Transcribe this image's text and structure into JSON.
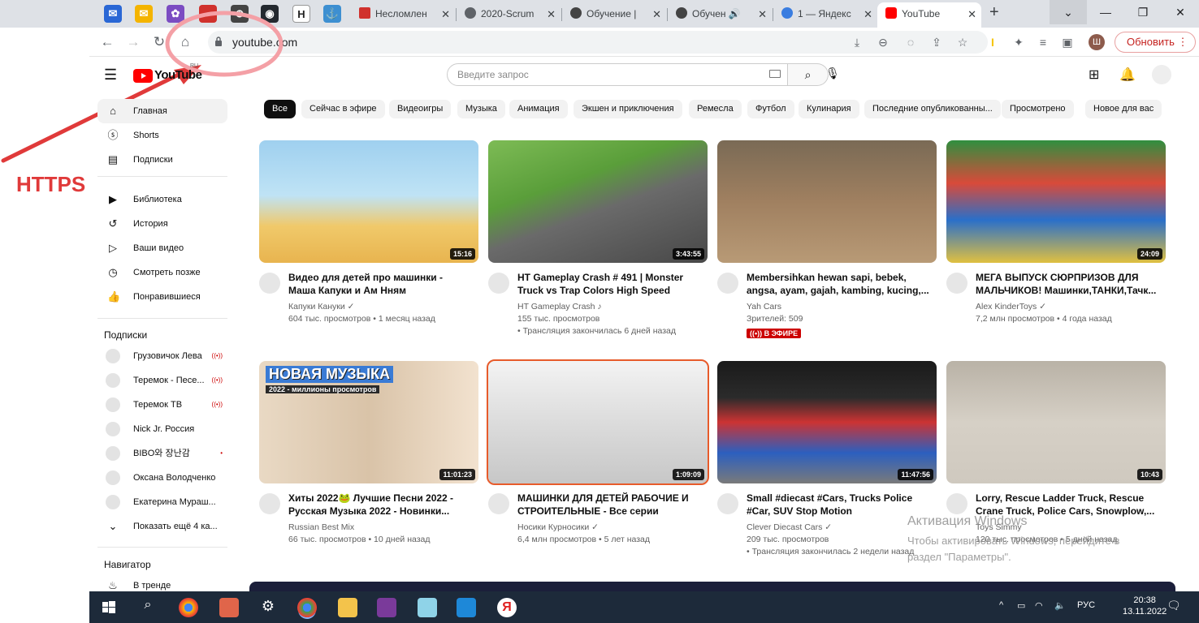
{
  "browser": {
    "tabs": [
      {
        "label": "Несломлен"
      },
      {
        "label": "2020-Scrum"
      },
      {
        "label": "Обучение |"
      },
      {
        "label": "Обучен"
      },
      {
        "label": "1 — Яндекс"
      },
      {
        "label": "YouTube"
      }
    ],
    "new_tab": "+",
    "url": "youtube.com",
    "update_label": "Обновить",
    "profile_initial": "Ш"
  },
  "youtube": {
    "logo": "YouTube",
    "logo_region": "RU",
    "search_placeholder": "Введите запрос",
    "sidebar": {
      "main": [
        {
          "label": "Главная",
          "icon": "home-icon"
        },
        {
          "label": "Shorts",
          "icon": "shorts-icon"
        },
        {
          "label": "Подписки",
          "icon": "subscriptions-icon"
        }
      ],
      "library": [
        {
          "label": "Библиотека",
          "icon": "library-icon"
        },
        {
          "label": "История",
          "icon": "history-icon"
        },
        {
          "label": "Ваши видео",
          "icon": "your-videos-icon"
        },
        {
          "label": "Смотреть позже",
          "icon": "watch-later-icon"
        },
        {
          "label": "Понравившиеся",
          "icon": "liked-icon"
        }
      ],
      "subs_header": "Подписки",
      "subs": [
        {
          "label": "Грузовичок Лева",
          "live": "((•))"
        },
        {
          "label": "Теремок - Песе...",
          "live": "((•))"
        },
        {
          "label": "Теремок ТВ",
          "live": "((•))"
        },
        {
          "label": "Nick Jr. Россия",
          "live": ""
        },
        {
          "label": "BIBO와 장난감",
          "live": "•"
        },
        {
          "label": "Оксана Володченко",
          "live": ""
        },
        {
          "label": "Екатерина Мураш...",
          "live": ""
        }
      ],
      "show_more": "Показать ещё 4 ка...",
      "nav_header": "Навигатор",
      "trending": "В тренде"
    },
    "chips": [
      "Все",
      "Сейчас в эфире",
      "Видеоигры",
      "Музыка",
      "Анимация",
      "Экшен и приключения",
      "Ремесла",
      "Футбол",
      "Кулинария",
      "Последние опубликованны...",
      "Просмотрено",
      "Новое для вас"
    ],
    "videos": [
      {
        "title": "Видео для детей про машинки - Маша Капуки и Ам Нням показываю...",
        "channel": "Капуки Кануки ✓",
        "meta1": "604 тыс. просмотров • 1 месяц назад",
        "meta2": "",
        "duration": "15:16",
        "badge": ""
      },
      {
        "title": "HT Gameplay Crash # 491 | Monster Truck vs Trap Colors High Speed Ram...",
        "channel": "HT Gameplay Crash ♪",
        "meta1": "155 тыс. просмотров",
        "meta2": "• Трансляция закончилась 6 дней назад",
        "duration": "3:43:55",
        "badge": ""
      },
      {
        "title": "Membersihkan hewan sapi, bebek, angsa, ayam, gajah, kambing, kucing,...",
        "channel": "Yah Cars",
        "meta1": "Зрителей: 509",
        "meta2": "",
        "duration": "",
        "badge": "((•)) В ЭФИРЕ"
      },
      {
        "title": "МЕГА ВЫПУСК СЮРПРИЗОВ ДЛЯ МАЛЬЧИКОВ! Машинки,ТАНКИ,Тачк...",
        "channel": "Alex KinderToys ✓",
        "meta1": "7,2 млн просмотров • 4 года назад",
        "meta2": "",
        "duration": "24:09",
        "badge": ""
      },
      {
        "title": "Хиты 2022🐸 Лучшие Песни 2022 - Русская Музыка 2022 - Новинки...",
        "channel": "Russian Best Mix",
        "meta1": "66 тыс. просмотров • 10 дней назад",
        "meta2": "",
        "duration": "11:01:23",
        "badge": ""
      },
      {
        "title": "МАШИНКИ ДЛЯ ДЕТЕЙ РАБОЧИЕ И СТРОИТЕЛЬНЫЕ - Все серии подряд...",
        "channel": "Носики Курносики ✓",
        "meta1": "6,4 млн просмотров • 5 лет назад",
        "meta2": "",
        "duration": "1:09:09",
        "badge": ""
      },
      {
        "title": "Small #diecast #Cars, Trucks Police #Car, SUV Stop Motion",
        "channel": "Clever Diecast Cars ✓",
        "meta1": "209 тыс. просмотров",
        "meta2": "• Трансляция закончилась 2 недели назад",
        "duration": "11:47:56",
        "badge": ""
      },
      {
        "title": "Lorry, Rescue Ladder Truck, Rescue Crane Truck, Police Cars, Snowplow,...",
        "channel": "Toys Simmy",
        "meta1": "120 тыс. просмотров • 5 дней назад",
        "meta2": "",
        "duration": "10:43",
        "badge": ""
      }
    ],
    "thumb_text": {
      "music_title": "НОВАЯ МУЗЫКА",
      "music_sub": "2022 - миллионы просмотров"
    }
  },
  "annotation": {
    "label": "HTTPS",
    "color": "#e03a3a"
  },
  "watermark": {
    "line1": "Активация Windows",
    "line2": "Чтобы активировать Windows, перейдите в",
    "line3": "раздел \"Параметры\"."
  },
  "taskbar": {
    "lang": "РУС",
    "time": "20:38",
    "date": "13.11.2022"
  },
  "colors": {
    "yt_red": "#ff0000",
    "live_red": "#cc0000",
    "update_red": "#c5221f"
  }
}
